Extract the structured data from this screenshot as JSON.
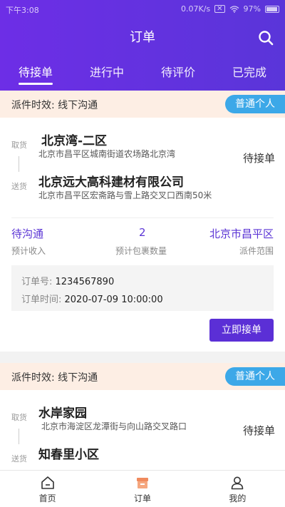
{
  "status_bar": {
    "time": "下午3:08",
    "speed": "0.07K/s",
    "battery": "97%"
  },
  "header": {
    "title": "订单"
  },
  "tabs": [
    {
      "label": "待接单",
      "active": true
    },
    {
      "label": "进行中",
      "active": false
    },
    {
      "label": "待评价",
      "active": false
    },
    {
      "label": "已完成",
      "active": false
    }
  ],
  "orders": [
    {
      "delivery_time_label": "派件时效: 线下沟通",
      "customer_type": "普通个人",
      "pickup_tag": "取货",
      "pickup_name": "北京湾-二区",
      "pickup_address": "北京市昌平区城南街道农场路北京湾",
      "dropoff_tag": "送货",
      "dropoff_name": "北京远大高科建材有限公司",
      "dropoff_address": "北京市昌平区宏斋路与雪上路交叉口西南50米",
      "status": "待接单",
      "income_value": "待沟通",
      "income_label": "预计收入",
      "parcels_value": "2",
      "parcels_label": "预计包裹数量",
      "range_value": "北京市昌平区",
      "range_label": "派件范围",
      "order_no_label": "订单号: ",
      "order_no": "1234567890",
      "order_time_label": "订单时间: ",
      "order_time": "2020-07-09 10:00:00",
      "accept_label": "立即接单"
    },
    {
      "delivery_time_label": "派件时效: 线下沟通",
      "customer_type": "普通个人",
      "pickup_tag": "取货",
      "pickup_name": "水岸家园",
      "pickup_address": "北京市海淀区龙潭街与向山路交叉路口",
      "dropoff_tag": "送货",
      "dropoff_name": "知春里小区",
      "status": "待接单"
    }
  ],
  "bottom_nav": [
    {
      "label": "首页",
      "icon": "home-icon"
    },
    {
      "label": "订单",
      "icon": "order-box-icon",
      "active": true
    },
    {
      "label": "我的",
      "icon": "user-icon"
    }
  ],
  "colors": {
    "primary": "#5b2fd6",
    "badge": "#3ca8e8",
    "type_bar_bg": "#fdeee4"
  }
}
